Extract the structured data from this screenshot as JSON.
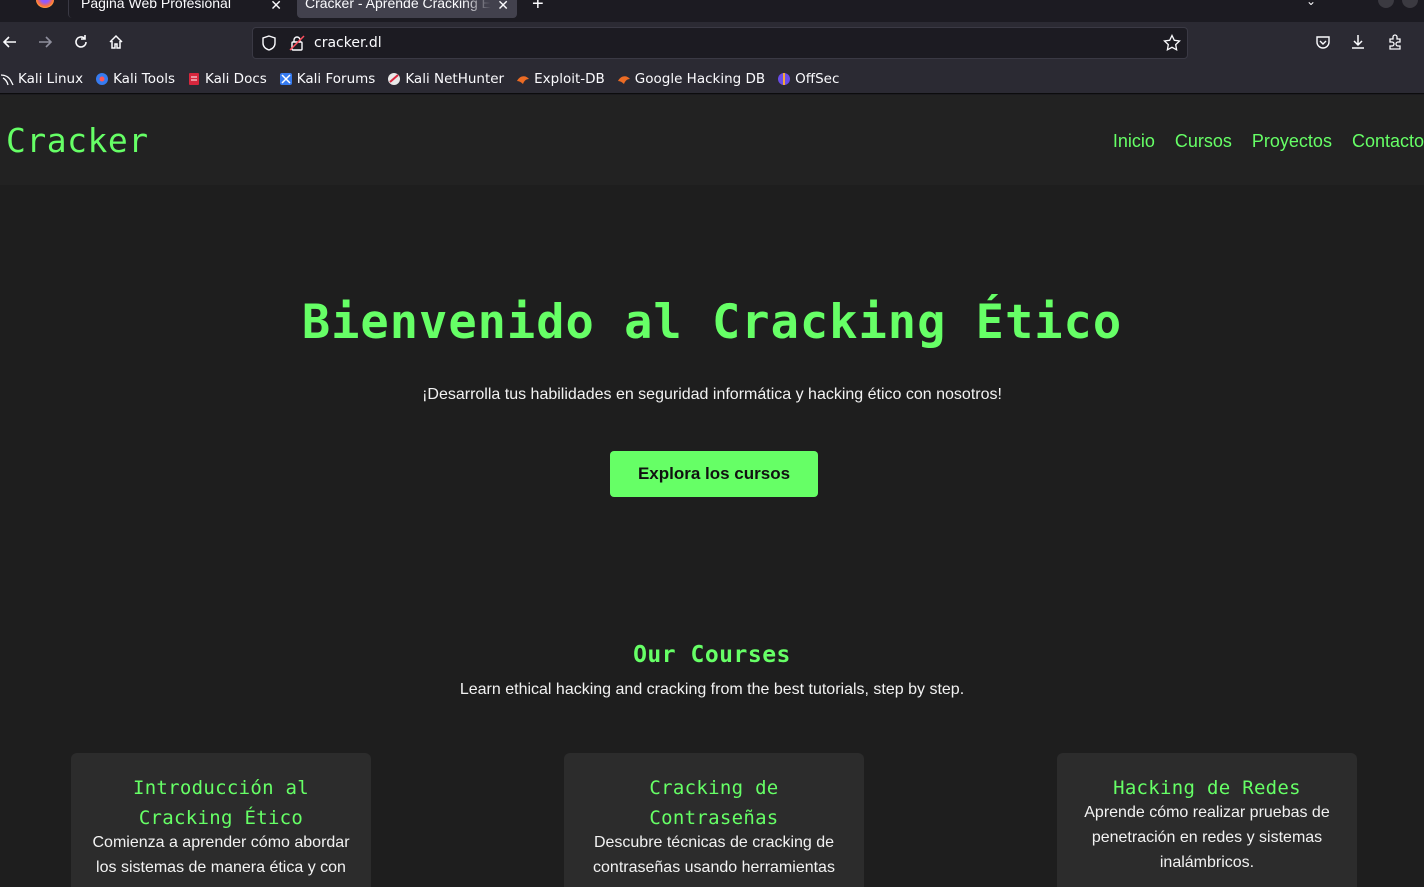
{
  "browser": {
    "tabs": [
      {
        "title": "Página Web Profesional"
      },
      {
        "title": "Cracker - Aprende Cracking Ético"
      }
    ],
    "url": "cracker.dl",
    "bookmarks": [
      {
        "label": "Kali Linux",
        "icon": "kali-dragon-icon"
      },
      {
        "label": "Kali Tools",
        "icon": "kali-tools-icon"
      },
      {
        "label": "Kali Docs",
        "icon": "kali-docs-icon"
      },
      {
        "label": "Kali Forums",
        "icon": "kali-forums-icon"
      },
      {
        "label": "Kali NetHunter",
        "icon": "kali-nethunter-icon"
      },
      {
        "label": "Exploit-DB",
        "icon": "exploit-db-icon"
      },
      {
        "label": "Google Hacking DB",
        "icon": "ghdb-icon"
      },
      {
        "label": "OffSec",
        "icon": "offsec-icon"
      }
    ]
  },
  "site": {
    "logo": "Cracker",
    "nav": [
      "Inicio",
      "Cursos",
      "Proyectos",
      "Contacto"
    ],
    "hero": {
      "title": "Bienvenido al Cracking Ético",
      "subtitle": "¡Desarrolla tus habilidades en seguridad informática y hacking ético con nosotros!",
      "button": "Explora los cursos"
    },
    "courses": {
      "title": "Our Courses",
      "subtitle": "Learn ethical hacking and cracking from the best tutorials, step by step.",
      "cards": [
        {
          "title": "Introducción al Cracking Ético",
          "text": "Comienza a aprender cómo abordar los sistemas de manera ética y con"
        },
        {
          "title": "Cracking de Contraseñas",
          "text": "Descubre técnicas de cracking de contraseñas usando herramientas"
        },
        {
          "title": "Hacking de Redes",
          "text": "Aprende cómo realizar pruebas de penetración en redes y sistemas inalámbricos."
        }
      ]
    }
  },
  "colors": {
    "accent": "#66ff66",
    "page_bg": "#1e1e1e",
    "header_bg": "#222222",
    "card_bg": "#2c2c2c"
  }
}
